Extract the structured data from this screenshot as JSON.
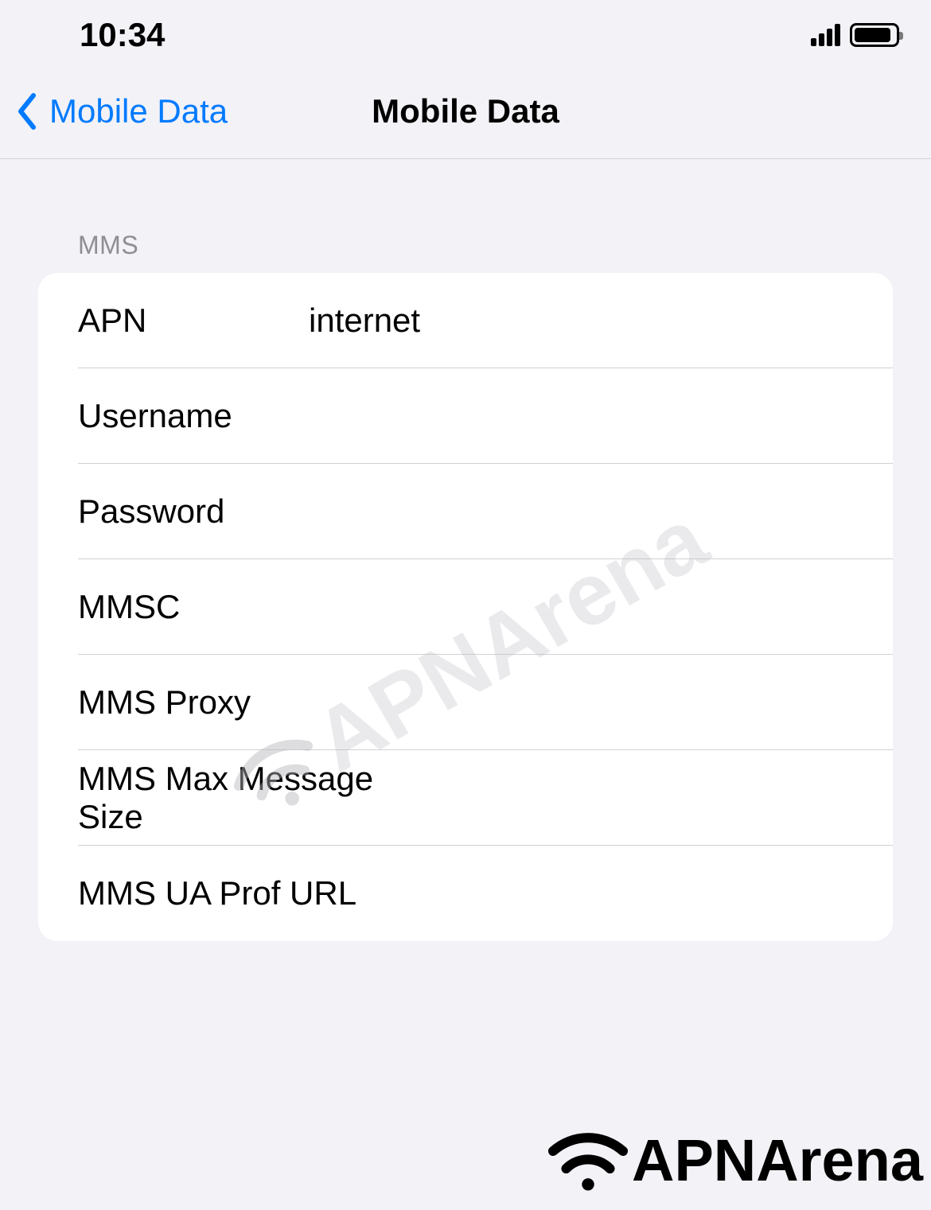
{
  "status": {
    "time": "10:34"
  },
  "nav": {
    "back_label": "Mobile Data",
    "title": "Mobile Data"
  },
  "section": {
    "header": "MMS",
    "fields": [
      {
        "label": "APN",
        "value": "internet"
      },
      {
        "label": "Username",
        "value": ""
      },
      {
        "label": "Password",
        "value": ""
      },
      {
        "label": "MMSC",
        "value": ""
      },
      {
        "label": "MMS Proxy",
        "value": ""
      },
      {
        "label": "MMS Max Message Size",
        "value": ""
      },
      {
        "label": "MMS UA Prof URL",
        "value": ""
      }
    ]
  },
  "watermark_text": "APNArena",
  "logo_text": "APNArena"
}
